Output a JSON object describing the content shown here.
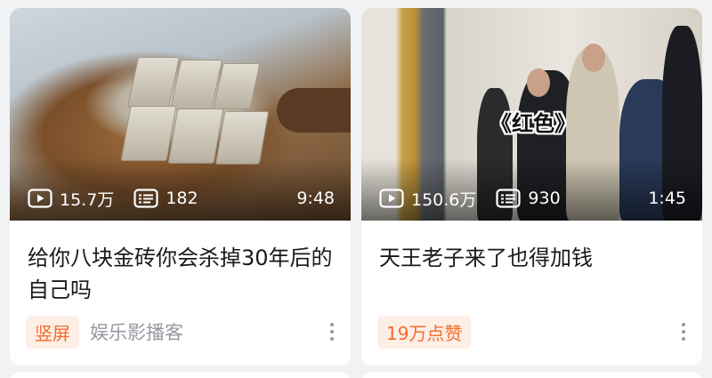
{
  "cards": [
    {
      "views": "15.7万",
      "danmaku": "182",
      "duration": "9:48",
      "title": "给你八块金砖你会杀掉30年后的自己吗",
      "tag": "竖屏",
      "author": "娱乐影播客"
    },
    {
      "views": "150.6万",
      "danmaku": "930",
      "duration": "1:45",
      "thumb_caption": "《红色》",
      "title": "天王老子来了也得加钱",
      "tag": "19万点赞",
      "author": ""
    }
  ],
  "icons": {
    "play": "play-icon",
    "danmaku": "danmaku-icon",
    "more": "more-vertical-icon"
  },
  "colors": {
    "background": "#f1f2f3",
    "card": "#ffffff",
    "tag_text": "#f56c2b",
    "tag_bg": "#fdeee6",
    "muted": "#9499a0",
    "title": "#18191c"
  }
}
